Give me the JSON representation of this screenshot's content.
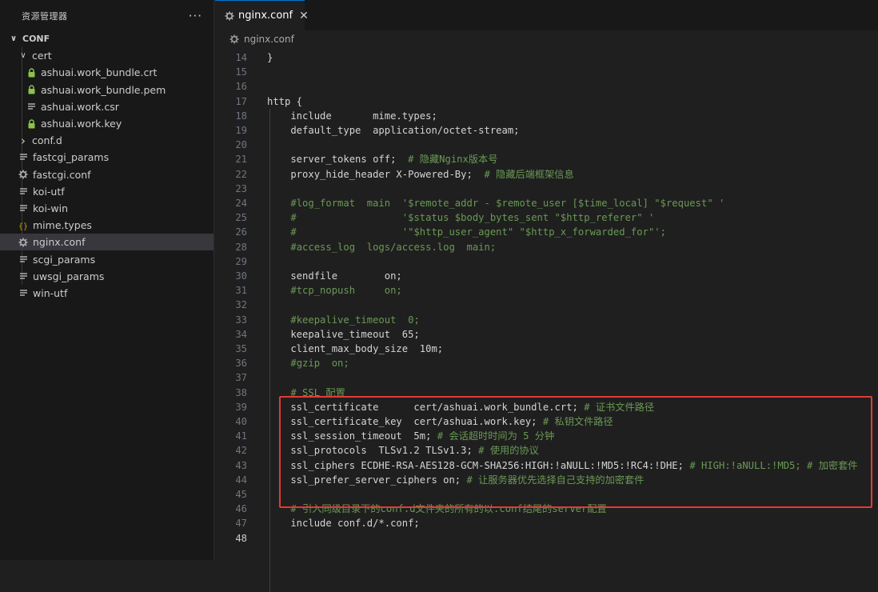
{
  "sidebar": {
    "title": "资源管理器",
    "more": "···",
    "root": "CONF",
    "items": [
      {
        "label": "cert",
        "kind": "folder-open",
        "depth": 1
      },
      {
        "label": "ashuai.work_bundle.crt",
        "kind": "lock",
        "depth": 2
      },
      {
        "label": "ashuai.work_bundle.pem",
        "kind": "lock",
        "depth": 2
      },
      {
        "label": "ashuai.work.csr",
        "kind": "lines",
        "depth": 2
      },
      {
        "label": "ashuai.work.key",
        "kind": "lock",
        "depth": 2
      },
      {
        "label": "conf.d",
        "kind": "folder-closed",
        "depth": 1
      },
      {
        "label": "fastcgi_params",
        "kind": "lines",
        "depth": 1
      },
      {
        "label": "fastcgi.conf",
        "kind": "gear",
        "depth": 1
      },
      {
        "label": "koi-utf",
        "kind": "lines",
        "depth": 1
      },
      {
        "label": "koi-win",
        "kind": "lines",
        "depth": 1
      },
      {
        "label": "mime.types",
        "kind": "braces",
        "depth": 1
      },
      {
        "label": "nginx.conf",
        "kind": "gear",
        "depth": 1,
        "selected": true
      },
      {
        "label": "scgi_params",
        "kind": "lines",
        "depth": 1
      },
      {
        "label": "uwsgi_params",
        "kind": "lines",
        "depth": 1
      },
      {
        "label": "win-utf",
        "kind": "lines",
        "depth": 1
      }
    ]
  },
  "tab": {
    "label": "nginx.conf",
    "close": "✕"
  },
  "breadcrumb": {
    "label": "nginx.conf"
  },
  "code": {
    "current_line": 48,
    "lines": [
      {
        "n": "14",
        "t": "}",
        "c": ""
      },
      {
        "n": "15",
        "t": "",
        "c": ""
      },
      {
        "n": "16",
        "t": "",
        "c": ""
      },
      {
        "n": "17",
        "t": "http {",
        "c": ""
      },
      {
        "n": "18",
        "t": "    include       mime.types;",
        "c": ""
      },
      {
        "n": "19",
        "t": "    default_type  application/octet-stream;",
        "c": ""
      },
      {
        "n": "20",
        "t": "",
        "c": ""
      },
      {
        "n": "21",
        "t": "    server_tokens off;  ",
        "c": "# 隐藏Nginx版本号"
      },
      {
        "n": "22",
        "t": "    proxy_hide_header X-Powered-By;  ",
        "c": "# 隐藏后端框架信息"
      },
      {
        "n": "23",
        "t": "",
        "c": ""
      },
      {
        "n": "24",
        "t": "    ",
        "c": "#log_format  main  '$remote_addr - $remote_user [$time_local] \"$request\" '"
      },
      {
        "n": "25",
        "t": "    ",
        "c": "#                  '$status $body_bytes_sent \"$http_referer\" '"
      },
      {
        "n": "26",
        "t": "    ",
        "c": "#                  '\"$http_user_agent\" \"$http_x_forwarded_for\"';"
      },
      {
        "n": "28",
        "t": "    ",
        "c": "#access_log  logs/access.log  main;"
      },
      {
        "n": "29",
        "t": "",
        "c": ""
      },
      {
        "n": "30",
        "t": "    sendfile        on;",
        "c": ""
      },
      {
        "n": "31",
        "t": "    ",
        "c": "#tcp_nopush     on;"
      },
      {
        "n": "32",
        "t": "",
        "c": ""
      },
      {
        "n": "33",
        "t": "    ",
        "c": "#keepalive_timeout  0;"
      },
      {
        "n": "34",
        "t": "    keepalive_timeout  65;",
        "c": ""
      },
      {
        "n": "35",
        "t": "    client_max_body_size  10m;",
        "c": ""
      },
      {
        "n": "36",
        "t": "    ",
        "c": "#gzip  on;"
      },
      {
        "n": "37",
        "t": "",
        "c": ""
      },
      {
        "n": "38",
        "t": "    ",
        "c": "# SSL 配置"
      },
      {
        "n": "39",
        "t": "    ssl_certificate      cert/ashuai.work_bundle.crt; ",
        "c": "# 证书文件路径"
      },
      {
        "n": "40",
        "t": "    ssl_certificate_key  cert/ashuai.work.key; ",
        "c": "# 私钥文件路径"
      },
      {
        "n": "41",
        "t": "    ssl_session_timeout  5m; ",
        "c": "# 会话超时时间为 5 分钟"
      },
      {
        "n": "42",
        "t": "    ssl_protocols  TLSv1.2 TLSv1.3; ",
        "c": "# 使用的协议"
      },
      {
        "n": "43",
        "t": "    ssl_ciphers ECDHE-RSA-AES128-GCM-SHA256:HIGH:!aNULL:!MD5:!RC4:!DHE; ",
        "c": "# HIGH:!aNULL:!MD5; # 加密套件"
      },
      {
        "n": "44",
        "t": "    ssl_prefer_server_ciphers on; ",
        "c": "# 让服务器优先选择自己支持的加密套件"
      },
      {
        "n": "45",
        "t": "",
        "c": ""
      },
      {
        "n": "46",
        "t": "    ",
        "c": "# 引入同级目录下的conf.d文件夹的所有的以.conf结尾的server配置"
      },
      {
        "n": "47",
        "t": "    include conf.d/*.conf;",
        "c": ""
      },
      {
        "n": "48",
        "t": "",
        "c": ""
      }
    ]
  },
  "colors": {
    "accent": "#0078d4",
    "highlight_box": "#e53935",
    "comment": "#6a9955",
    "lock": "#8bc34a"
  }
}
